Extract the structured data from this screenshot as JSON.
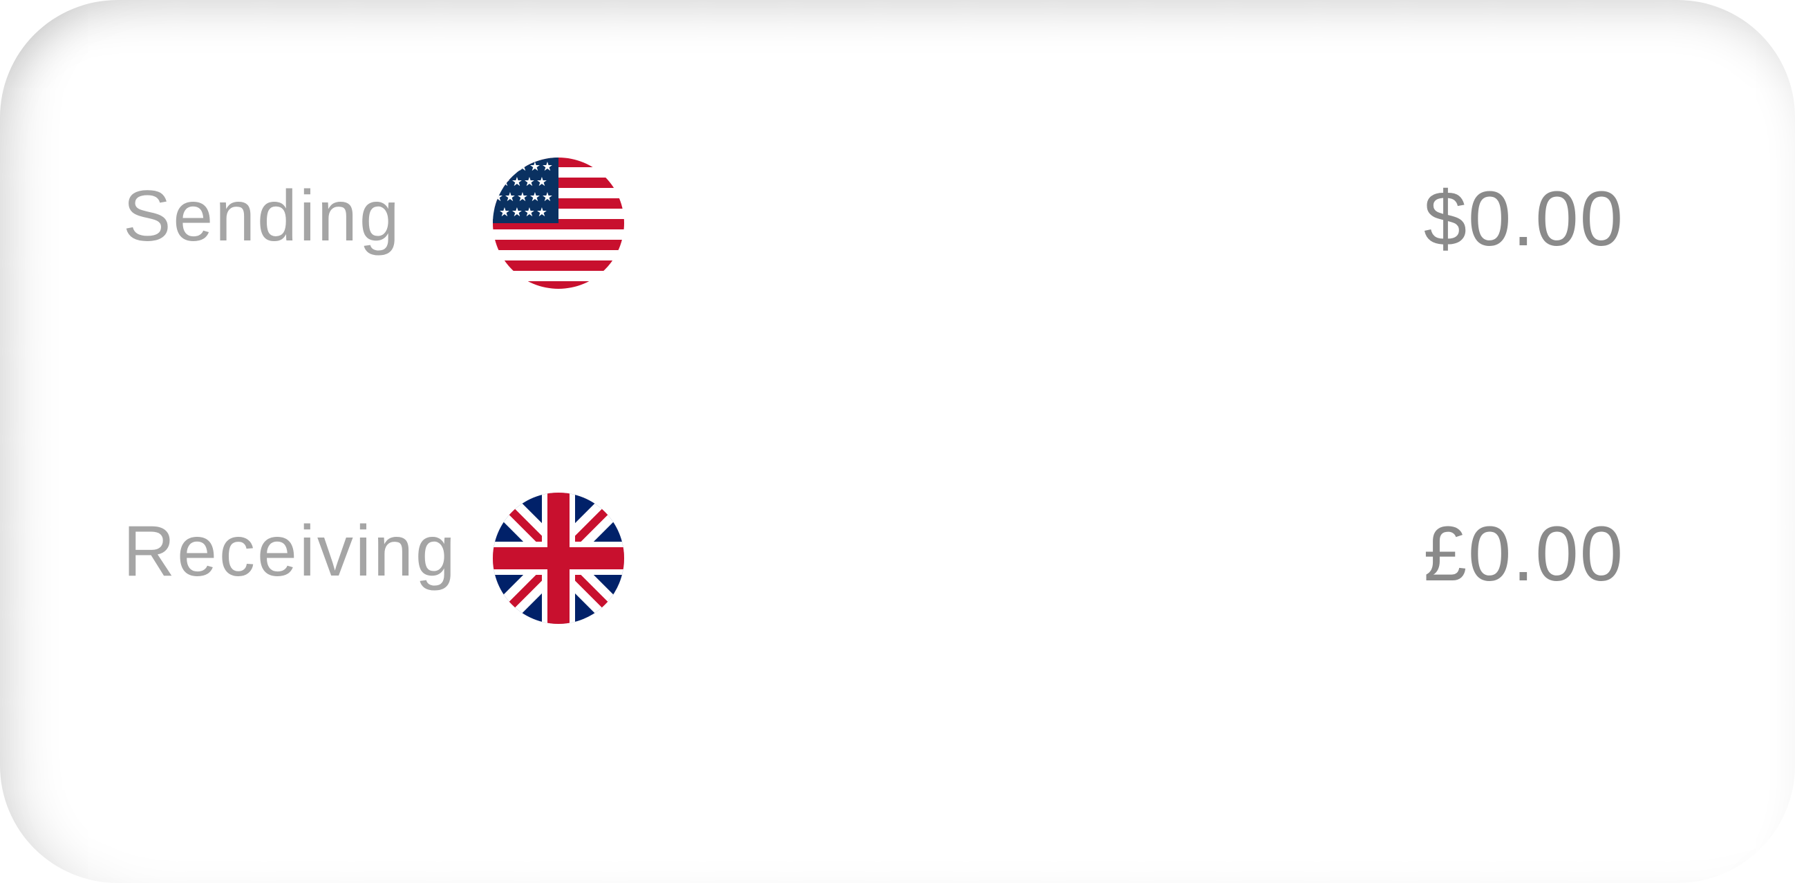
{
  "converter": {
    "sending": {
      "label": "Sending",
      "amount": "$0.00",
      "flag": "us-flag-icon"
    },
    "receiving": {
      "label": "Receiving",
      "amount": "£0.00",
      "flag": "uk-flag-icon"
    }
  },
  "colors": {
    "text_label": "#a5a5a5",
    "text_amount": "#8a8a8a",
    "flag_red": "#c8102e",
    "flag_blue": "#012169",
    "us_blue": "#0a3161"
  }
}
